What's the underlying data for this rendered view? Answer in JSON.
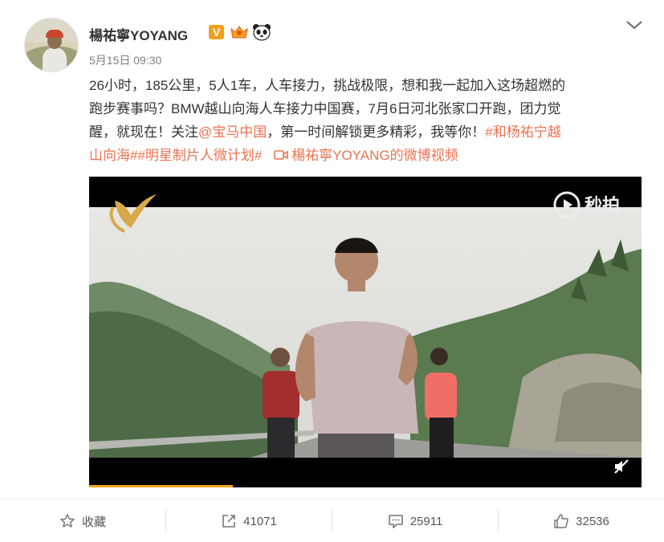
{
  "post": {
    "author": "楊祐寧YOYANG",
    "timestamp": "5月15日 09:30",
    "content": {
      "line1": "26小时，185公里，5人1车，人车接力，挑战极限，想和我一起加入这场超燃的",
      "line2": "跑步赛事吗？BMW越山向海人车接力中国赛，7月6日河北张家口开跑，团力觉",
      "line3_a": "醒，就现在！关注",
      "mention": "@宝马中国",
      "line3_b": "，第一时间解锁更多精彩，我等你！",
      "hashtag1_a": "#和杨祐宁越",
      "hashtag1_b": "山向海#",
      "hashtag2": "#明星制片人微计划#",
      "video_link": "楊祐寧YOYANG的微博视频"
    },
    "video": {
      "watermark_label": "秒拍",
      "progress": 0.26
    }
  },
  "actions": {
    "favorite": "收藏",
    "repost": "41071",
    "comment": "25911",
    "like": "32536"
  },
  "colors": {
    "link": "#eb7350",
    "verified": "#f0a01c",
    "progress": "#f7a21b"
  },
  "icons": [
    "verified-v-icon",
    "member-crown-icon",
    "panda-icon",
    "chevron-down-icon",
    "video-link-icon",
    "miaopai-logo-icon",
    "mute-icon",
    "star-icon",
    "repost-icon",
    "comment-icon",
    "like-icon"
  ]
}
